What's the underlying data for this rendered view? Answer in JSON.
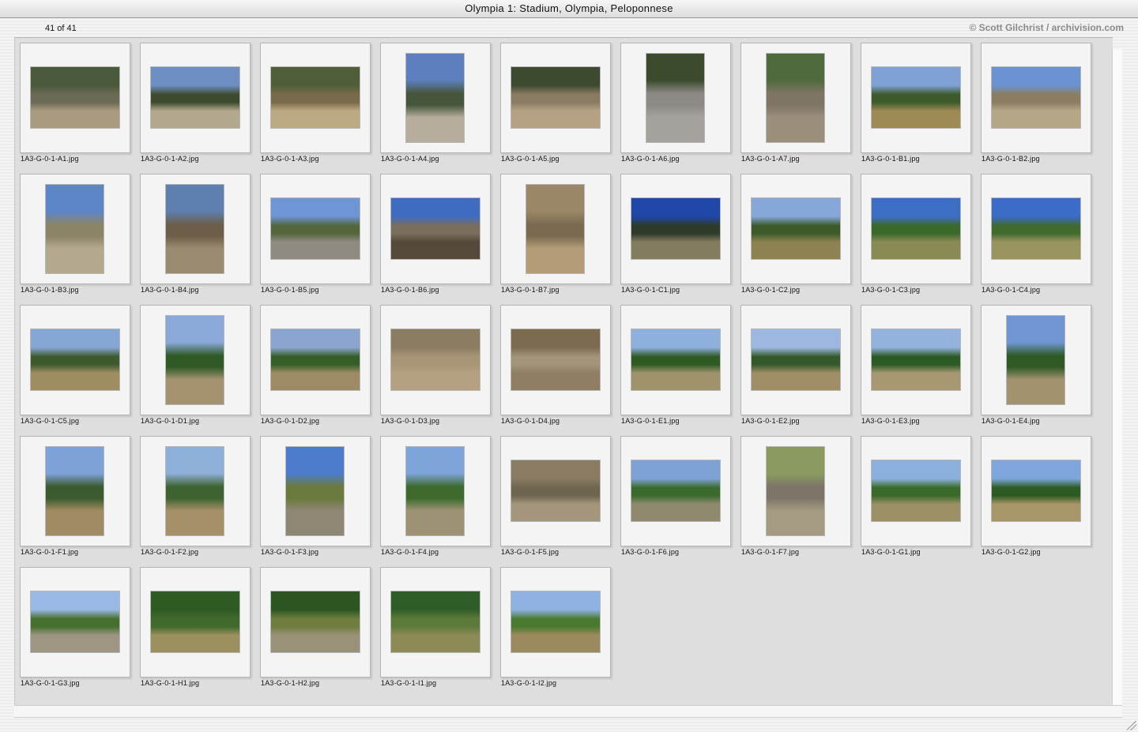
{
  "window": {
    "title": "Olympia 1: Stadium, Olympia, Peloponnese",
    "count": "41 of 41",
    "credit": "© Scott Gilchrist / archivision.com"
  },
  "thumbnails": [
    {
      "file": "1A3-G-0-1-A1.jpg",
      "orientation": "landscape",
      "colors": [
        "#4a5a3a",
        "#6b6a55",
        "#a89b80"
      ]
    },
    {
      "file": "1A3-G-0-1-A2.jpg",
      "orientation": "landscape",
      "colors": [
        "#6d8fc4",
        "#3e4a2e",
        "#b3a78d"
      ]
    },
    {
      "file": "1A3-G-0-1-A3.jpg",
      "orientation": "landscape",
      "colors": [
        "#4f5e36",
        "#7a6a4c",
        "#bda983"
      ]
    },
    {
      "file": "1A3-G-0-1-A4.jpg",
      "orientation": "portrait",
      "colors": [
        "#5d7fbe",
        "#45563a",
        "#b6ad9c"
      ]
    },
    {
      "file": "1A3-G-0-1-A5.jpg",
      "orientation": "landscape",
      "colors": [
        "#3e4a30",
        "#8a7c62",
        "#b5a285"
      ]
    },
    {
      "file": "1A3-G-0-1-A6.jpg",
      "orientation": "portrait",
      "colors": [
        "#3b4b2c",
        "#8d8985",
        "#a5a29e"
      ]
    },
    {
      "file": "1A3-G-0-1-A7.jpg",
      "orientation": "portrait",
      "colors": [
        "#4f6a3c",
        "#7f7566",
        "#9b8f7c"
      ]
    },
    {
      "file": "1A3-G-0-1-B1.jpg",
      "orientation": "landscape",
      "colors": [
        "#7fa1d6",
        "#3d5a2a",
        "#9d8a55"
      ]
    },
    {
      "file": "1A3-G-0-1-B2.jpg",
      "orientation": "landscape",
      "colors": [
        "#6b93d2",
        "#8a7d60",
        "#b4a788"
      ]
    },
    {
      "file": "1A3-G-0-1-B3.jpg",
      "orientation": "portrait",
      "colors": [
        "#5c86c8",
        "#8c8467",
        "#b4a98f"
      ]
    },
    {
      "file": "1A3-G-0-1-B4.jpg",
      "orientation": "portrait",
      "colors": [
        "#5f7fb0",
        "#6c5e48",
        "#9a8b70"
      ]
    },
    {
      "file": "1A3-G-0-1-B5.jpg",
      "orientation": "landscape",
      "colors": [
        "#6e95d4",
        "#54663c",
        "#8f8b80"
      ]
    },
    {
      "file": "1A3-G-0-1-B6.jpg",
      "orientation": "landscape",
      "colors": [
        "#3f6bc0",
        "#7a6e5c",
        "#54493a"
      ]
    },
    {
      "file": "1A3-G-0-1-B7.jpg",
      "orientation": "portrait",
      "colors": [
        "#9b8768",
        "#7a6a4f",
        "#b39c77"
      ]
    },
    {
      "file": "1A3-G-0-1-C1.jpg",
      "orientation": "landscape",
      "colors": [
        "#1f47a8",
        "#2d3b2a",
        "#847c5f"
      ]
    },
    {
      "file": "1A3-G-0-1-C2.jpg",
      "orientation": "landscape",
      "colors": [
        "#86a7d8",
        "#3c5a2a",
        "#8c8252"
      ]
    },
    {
      "file": "1A3-G-0-1-C3.jpg",
      "orientation": "landscape",
      "colors": [
        "#3d6ec6",
        "#3a6a2a",
        "#8a8a55"
      ]
    },
    {
      "file": "1A3-G-0-1-C4.jpg",
      "orientation": "landscape",
      "colors": [
        "#3c6bc8",
        "#3f6b2d",
        "#9a9560"
      ]
    },
    {
      "file": "1A3-G-0-1-C5.jpg",
      "orientation": "landscape",
      "colors": [
        "#86a7d4",
        "#3d5a2e",
        "#9e8d60"
      ]
    },
    {
      "file": "1A3-G-0-1-D1.jpg",
      "orientation": "portrait",
      "colors": [
        "#8aa9d8",
        "#2f5a26",
        "#a59370"
      ]
    },
    {
      "file": "1A3-G-0-1-D2.jpg",
      "orientation": "landscape",
      "colors": [
        "#8aa6d0",
        "#355f28",
        "#9e8b65"
      ]
    },
    {
      "file": "1A3-G-0-1-D3.jpg",
      "orientation": "landscape",
      "colors": [
        "#8c7d62",
        "#a89576",
        "#b5a181"
      ]
    },
    {
      "file": "1A3-G-0-1-D4.jpg",
      "orientation": "landscape",
      "colors": [
        "#7d6b4f",
        "#a49479",
        "#8f7e61"
      ]
    },
    {
      "file": "1A3-G-0-1-E1.jpg",
      "orientation": "landscape",
      "colors": [
        "#8fb0dc",
        "#2e5a24",
        "#a0936b"
      ]
    },
    {
      "file": "1A3-G-0-1-E2.jpg",
      "orientation": "landscape",
      "colors": [
        "#9db8e0",
        "#33592a",
        "#a08f66"
      ]
    },
    {
      "file": "1A3-G-0-1-E3.jpg",
      "orientation": "landscape",
      "colors": [
        "#93b2dc",
        "#2c5a24",
        "#a79872"
      ]
    },
    {
      "file": "1A3-G-0-1-E4.jpg",
      "orientation": "portrait",
      "colors": [
        "#6f96d2",
        "#2f5a26",
        "#a39270"
      ]
    },
    {
      "file": "1A3-G-0-1-F1.jpg",
      "orientation": "portrait",
      "colors": [
        "#7ea2d8",
        "#3b5a2e",
        "#a08b62"
      ]
    },
    {
      "file": "1A3-G-0-1-F2.jpg",
      "orientation": "portrait",
      "colors": [
        "#8eafd8",
        "#3e6330",
        "#a69068"
      ]
    },
    {
      "file": "1A3-G-0-1-F3.jpg",
      "orientation": "portrait",
      "colors": [
        "#4d7ccc",
        "#6b7a3c",
        "#8e8774"
      ]
    },
    {
      "file": "1A3-G-0-1-F4.jpg",
      "orientation": "portrait",
      "colors": [
        "#7ea4da",
        "#3d6a2c",
        "#9e9274"
      ]
    },
    {
      "file": "1A3-G-0-1-F5.jpg",
      "orientation": "landscape",
      "colors": [
        "#8a7c63",
        "#6e6550",
        "#a3967c"
      ]
    },
    {
      "file": "1A3-G-0-1-F6.jpg",
      "orientation": "landscape",
      "colors": [
        "#7fa2d6",
        "#3a6a2c",
        "#8f8a6e"
      ]
    },
    {
      "file": "1A3-G-0-1-F7.jpg",
      "orientation": "portrait",
      "colors": [
        "#8a9a60",
        "#7d7568",
        "#a59b82"
      ]
    },
    {
      "file": "1A3-G-0-1-G1.jpg",
      "orientation": "landscape",
      "colors": [
        "#8cb0de",
        "#3a6a2a",
        "#9c9064"
      ]
    },
    {
      "file": "1A3-G-0-1-G2.jpg",
      "orientation": "landscape",
      "colors": [
        "#7ea6dc",
        "#2c5a22",
        "#a89568"
      ]
    },
    {
      "file": "1A3-G-0-1-G3.jpg",
      "orientation": "landscape",
      "colors": [
        "#9ab8e4",
        "#45702e",
        "#9e9682"
      ]
    },
    {
      "file": "1A3-G-0-1-H1.jpg",
      "orientation": "landscape",
      "colors": [
        "#2e5a24",
        "#3f6a2c",
        "#9c915e"
      ]
    },
    {
      "file": "1A3-G-0-1-H2.jpg",
      "orientation": "landscape",
      "colors": [
        "#2c5522",
        "#6f7d3f",
        "#9a9278"
      ]
    },
    {
      "file": "1A3-G-0-1-I1.jpg",
      "orientation": "landscape",
      "colors": [
        "#2f5d27",
        "#5e7a3a",
        "#8c8a55"
      ]
    },
    {
      "file": "1A3-G-0-1-I2.jpg",
      "orientation": "landscape",
      "colors": [
        "#8fb2e2",
        "#4a7a2f",
        "#9c8a5e"
      ]
    }
  ]
}
